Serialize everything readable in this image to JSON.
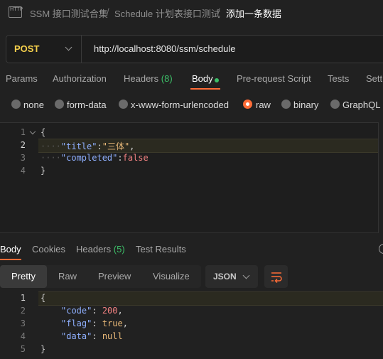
{
  "breadcrumb": {
    "icon_text": "HTTP",
    "collection": "SSM 接口测试合集",
    "folder": "Schedule 计划表接口测试",
    "request": "添加一条数据",
    "separator": "/"
  },
  "request": {
    "method": "POST",
    "url": "http://localhost:8080/ssm/schedule"
  },
  "request_tabs": {
    "params": "Params",
    "authorization": "Authorization",
    "headers": "Headers",
    "headers_count": "(8)",
    "body": "Body",
    "prerequest": "Pre-request Script",
    "tests": "Tests",
    "settings": "Sett"
  },
  "body_types": {
    "none": "none",
    "form_data": "form-data",
    "urlencoded": "x-www-form-urlencoded",
    "raw": "raw",
    "binary": "binary",
    "graphql": "GraphQL",
    "selected": "raw"
  },
  "request_body": {
    "line_numbers": [
      "1",
      "2",
      "3",
      "4"
    ],
    "open_brace": "{",
    "title_key": "\"title\"",
    "title_colon": ":",
    "title_value": "\"三体\"",
    "title_comma": ",",
    "completed_key": "\"completed\"",
    "completed_colon": ":",
    "completed_value": "false",
    "close_brace": "}",
    "indent_dots": "····"
  },
  "response_tabs": {
    "body": "Body",
    "cookies": "Cookies",
    "headers": "Headers",
    "headers_count": "(5)",
    "test_results": "Test Results"
  },
  "response_view": {
    "pretty": "Pretty",
    "raw": "Raw",
    "preview": "Preview",
    "visualize": "Visualize",
    "format": "JSON"
  },
  "response_body": {
    "line_numbers": [
      "1",
      "2",
      "3",
      "4",
      "5"
    ],
    "open_brace": "{",
    "code_key": "\"code\"",
    "code_value": "200",
    "flag_key": "\"flag\"",
    "flag_value": "true",
    "data_key": "\"data\"",
    "data_value": "null",
    "colon": ": ",
    "comma": ",",
    "close_brace": "}"
  },
  "colors": {
    "accent": "#ff6c37",
    "method": "#f5d04c",
    "success": "#3cbf68"
  }
}
